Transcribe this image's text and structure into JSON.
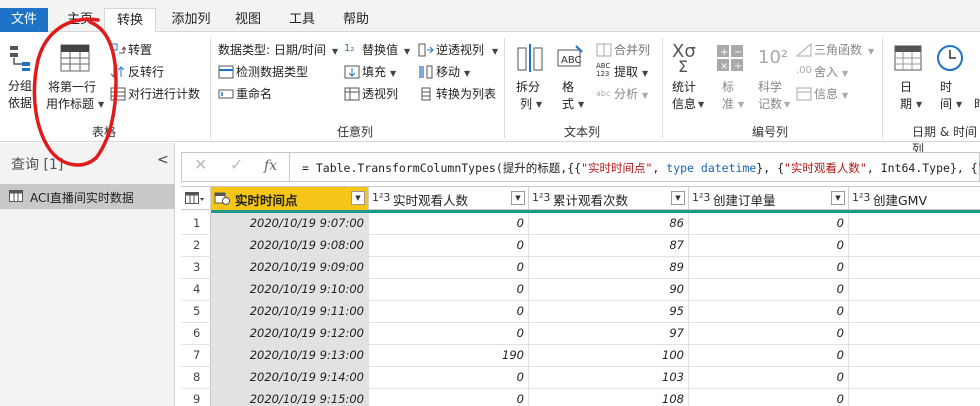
{
  "tabs": [
    "文件",
    "主页",
    "转换",
    "添加列",
    "视图",
    "工具",
    "帮助"
  ],
  "ribbon": {
    "table": {
      "group_by": [
        "分组",
        "依据"
      ],
      "first_row_header": [
        "将第一行",
        "用作标题"
      ],
      "transpose": "转置",
      "reverse_rows": "反转行",
      "count_rows": "对行进行计数",
      "label": "表格"
    },
    "any_column": {
      "data_type": "数据类型: 日期/时间",
      "detect_type": "检测数据类型",
      "rename": "重命名",
      "replace_values": "替换值",
      "fill": "填充",
      "pivot": "透视列",
      "unpivot": "逆透视列",
      "move": "移动",
      "to_list": "转换为列表",
      "label": "任意列"
    },
    "text_column": {
      "split": [
        "拆分",
        "列"
      ],
      "format": [
        "格",
        "式"
      ],
      "merge": "合并列",
      "extract": "提取",
      "parse": "分析",
      "label": "文本列"
    },
    "number_column": {
      "statistics": [
        "统计",
        "信息"
      ],
      "standard": [
        "标",
        "准"
      ],
      "scientific": [
        "科学",
        "记数"
      ],
      "trig": "三角函数",
      "rounding": "舍入",
      "information": "信息",
      "label": "编号列"
    },
    "date_column": {
      "date": [
        "日",
        "期"
      ],
      "time": [
        "时",
        "间"
      ],
      "duration": "时",
      "label": "日期 & 时间列"
    }
  },
  "queries": {
    "header": "查询 [1]",
    "items": [
      "ACI直播间实时数据"
    ]
  },
  "formula": {
    "prefix": "= Table.TransformColumnTypes(提升的标题,{{",
    "s1": "\"实时时间点\"",
    "t1": "type datetime",
    "mid": "}, {",
    "s2": "\"实时观看人数\"",
    "t2": ", Int64.Type}, {",
    "s3": "\"累"
  },
  "grid": {
    "columns": [
      {
        "type": "",
        "name": "实时时间点",
        "selected": true
      },
      {
        "type": "1²3",
        "name": "实时观看人数"
      },
      {
        "type": "1²3",
        "name": "累计观看次数"
      },
      {
        "type": "1²3",
        "name": "创建订单量"
      },
      {
        "type": "1²3",
        "name": "创建GMV"
      }
    ],
    "rows": [
      {
        "n": "1",
        "time": "2020/10/19 9:07:00",
        "viewers": "0",
        "total": "86",
        "orders": "0",
        "gmv": ""
      },
      {
        "n": "2",
        "time": "2020/10/19 9:08:00",
        "viewers": "0",
        "total": "87",
        "orders": "0",
        "gmv": ""
      },
      {
        "n": "3",
        "time": "2020/10/19 9:09:00",
        "viewers": "0",
        "total": "89",
        "orders": "0",
        "gmv": ""
      },
      {
        "n": "4",
        "time": "2020/10/19 9:10:00",
        "viewers": "0",
        "total": "90",
        "orders": "0",
        "gmv": ""
      },
      {
        "n": "5",
        "time": "2020/10/19 9:11:00",
        "viewers": "0",
        "total": "95",
        "orders": "0",
        "gmv": ""
      },
      {
        "n": "6",
        "time": "2020/10/19 9:12:00",
        "viewers": "0",
        "total": "97",
        "orders": "0",
        "gmv": ""
      },
      {
        "n": "7",
        "time": "2020/10/19 9:13:00",
        "viewers": "190",
        "total": "100",
        "orders": "0",
        "gmv": ""
      },
      {
        "n": "8",
        "time": "2020/10/19 9:14:00",
        "viewers": "0",
        "total": "103",
        "orders": "0",
        "gmv": ""
      },
      {
        "n": "9",
        "time": "2020/10/19 9:15:00",
        "viewers": "0",
        "total": "108",
        "orders": "0",
        "gmv": ""
      }
    ]
  },
  "colors": {
    "file_tab": "#1f73c7",
    "selected_header": "#f5c518",
    "header_accent": "#1a9a8a",
    "annotation": "#e01b1b"
  }
}
